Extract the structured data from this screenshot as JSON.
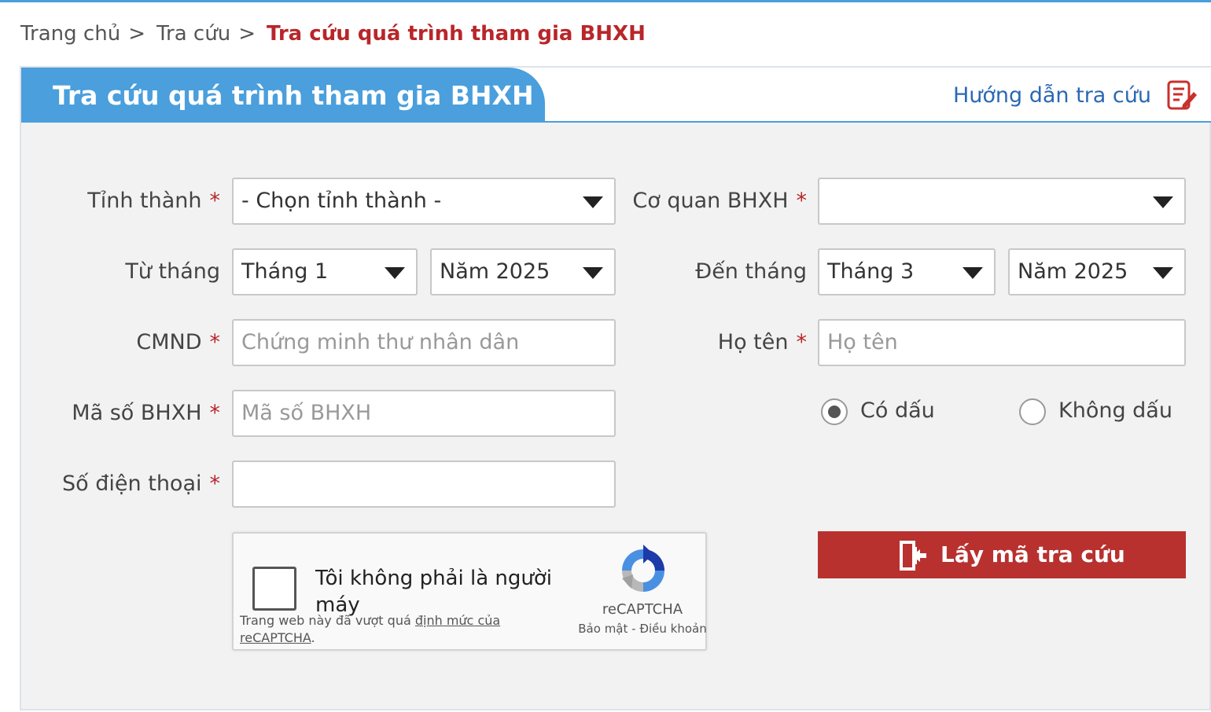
{
  "breadcrumb": {
    "home": "Trang chủ",
    "lookup": "Tra cứu",
    "current": "Tra cứu quá trình tham gia BHXH",
    "separator": ">"
  },
  "panel": {
    "title": "Tra cứu quá trình tham gia BHXH",
    "guide_link": "Hướng dẫn tra cứu"
  },
  "form": {
    "required_mark": "*",
    "province": {
      "label": "Tỉnh thành",
      "value": "- Chọn tỉnh thành -"
    },
    "agency": {
      "label": "Cơ quan BHXH",
      "value": ""
    },
    "from": {
      "label": "Từ tháng",
      "month": "Tháng 1",
      "year": "Năm 2025"
    },
    "to": {
      "label": "Đến tháng",
      "month": "Tháng 3",
      "year": "Năm 2025"
    },
    "id_card": {
      "label": "CMND",
      "placeholder": "Chứng minh thư nhân dân",
      "value": ""
    },
    "full_name": {
      "label": "Họ tên",
      "placeholder": "Họ tên",
      "value": ""
    },
    "social_id": {
      "label": "Mã số BHXH",
      "placeholder": "Mã số BHXH",
      "value": ""
    },
    "phone": {
      "label": "Số điện thoại",
      "value": ""
    },
    "accent_options": [
      {
        "label": "Có dấu",
        "checked": true
      },
      {
        "label": "Không dấu",
        "checked": false
      }
    ]
  },
  "captcha": {
    "label": "Tôi không phải là người máy",
    "warning_prefix": "Trang web này đã vượt quá ",
    "warning_link": "định mức của reCAPTCHA",
    "warning_suffix": ".",
    "brand": "reCAPTCHA",
    "privacy": "Bảo mật",
    "terms_sep": " - ",
    "terms": "Điều khoản"
  },
  "submit": {
    "label": "Lấy mã tra cứu"
  },
  "colors": {
    "accent_blue": "#4a9fdc",
    "accent_red": "#b8262a",
    "button_red": "#b8312f",
    "link_blue": "#2c68b3"
  }
}
